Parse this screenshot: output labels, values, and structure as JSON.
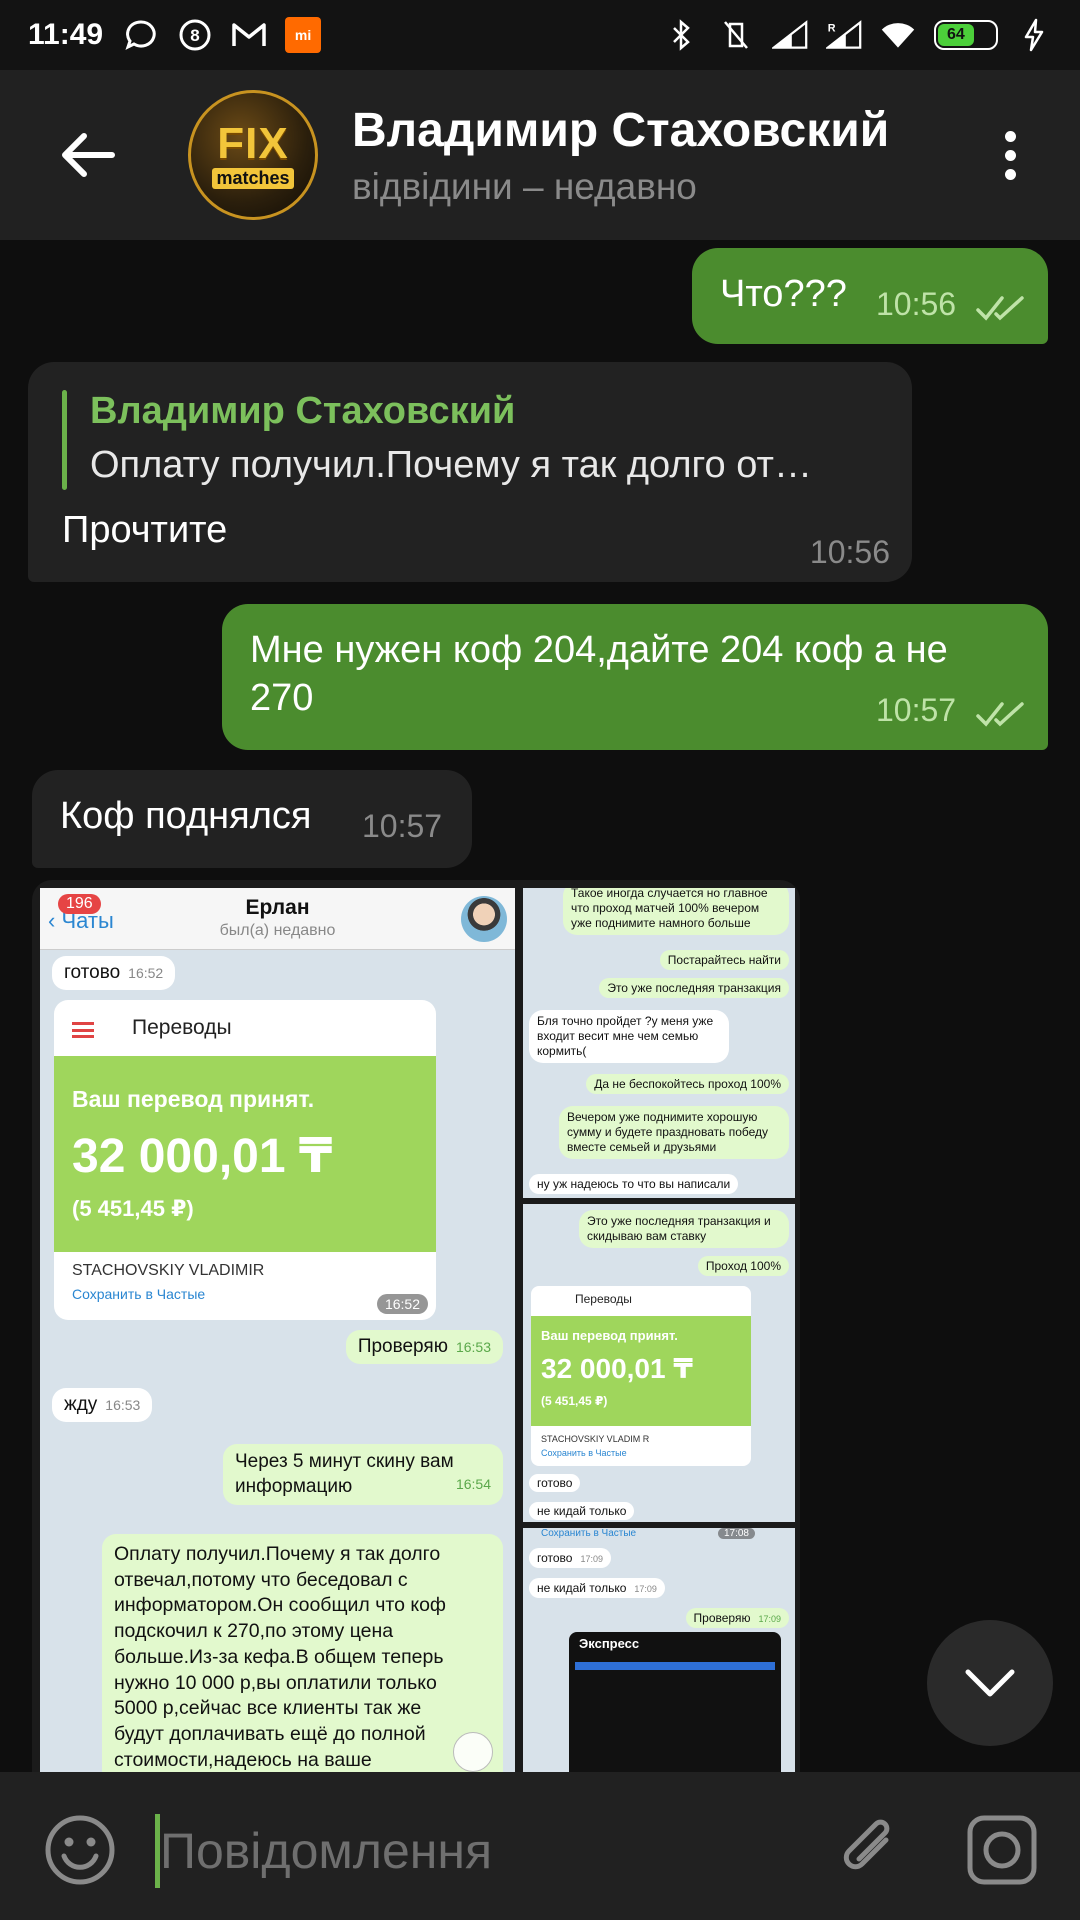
{
  "status_bar": {
    "time": "11:49",
    "battery": "64",
    "mi_label": "mi"
  },
  "header": {
    "contact_name": "Владимир Стаховский",
    "last_seen": "відвідини – недавно",
    "avatar_text_1": "FIX",
    "avatar_text_2": "matches"
  },
  "messages": {
    "m1": {
      "text": "Что???",
      "time": "10:56"
    },
    "m2": {
      "reply_name": "Владимир Стаховский",
      "reply_text": "Оплату получил.Почему я так долго от…",
      "text": "Прочтите",
      "time": "10:56"
    },
    "m3": {
      "text_line1": "Мне нужен коф 204,дайте 204 коф а не",
      "text_line2": "270",
      "time": "10:57"
    },
    "m4": {
      "text": "Коф поднялся",
      "time": "10:57"
    }
  },
  "album": {
    "big": {
      "badge": "196",
      "back": "Чаты",
      "title": "Ерлан",
      "subtitle": "был(а) недавно",
      "b1": "готово",
      "b1_time": "16:52",
      "card_title": "Переводы",
      "card_line1": "Ваш перевод принят.",
      "card_amount": "32 000,01 ₸",
      "card_rub": "(5 451,45 ₽)",
      "card_name": "STACHOVSKIY VLADIMIR",
      "card_save": "Сохранить в Частые",
      "card_time": "16:52",
      "b2": "Проверяю",
      "b2_time": "16:53",
      "b3": "жду",
      "b3_time": "16:53",
      "b4_line1": "Через 5 минут скину вам",
      "b4_line2": "информацию",
      "b4_time": "16:54",
      "b5_line1": "Оплату получил.Почему я так долго",
      "b5_line2": "отвечал,потому что беседовал с",
      "b5_line3": "информатором.Он сообщил что коф",
      "b5_line4": "подскочил к 270,по этому цена",
      "b5_line5": "больше.Из-за кефа.В общем теперь",
      "b5_line6": "нужно 10 000 р,вы оплатили только",
      "b5_line7": "5000 р,сейчас все клиенты так же",
      "b5_line8": "будут доплачивать ещё до полной",
      "b5_line9": "стоимости,надеюсь на ваше"
    },
    "s1": {
      "a": "Такое иногда случается но главное что проход матчей 100% вечером уже поднимите намного больше",
      "b": "Постарайтесь найти",
      "c": "Это уже последняя транзакция",
      "d": "Бля точно пройдет ?у меня уже входит весит мне чем семью кормить(",
      "e": "Да не беспокойтесь проход 100%",
      "f": "Вечером уже поднимите хорошую сумму и будете праздновать победу вместе семьей и друзьями",
      "g": "ну уж надеюсь то что вы написали"
    },
    "s2": {
      "a": "Это уже последняя транзакция и скидываю вам ставку",
      "b": "Проход 100%",
      "card_title": "Переводы",
      "card_line1": "Ваш перевод принят.",
      "card_amount": "32 000,01 ₸",
      "card_rub": "(5 451,45 ₽)",
      "card_name": "STACHOVSKIY VLADIM R",
      "card_save": "Сохранить в Частые",
      "c": "готово",
      "d": "не кидай только"
    },
    "s3": {
      "top": "Сохранить в Частые",
      "top_time": "17:08",
      "a": "готово",
      "a_time": "17:09",
      "b": "не кидай только",
      "b_time": "17:09",
      "c": "Проверяю",
      "c_time": "17:09",
      "dark_title": "Экспресс"
    }
  },
  "input": {
    "placeholder": "Повідомлення"
  },
  "colors": {
    "outgoing_bubble": "#4b8c2e",
    "incoming_bubble": "#222222",
    "accent_green": "#6bb24a"
  },
  "icons": [
    "back-arrow-icon",
    "more-vert-icon",
    "double-check-icon",
    "chevron-down-icon",
    "emoji-icon",
    "attach-icon",
    "camera-icon"
  ]
}
